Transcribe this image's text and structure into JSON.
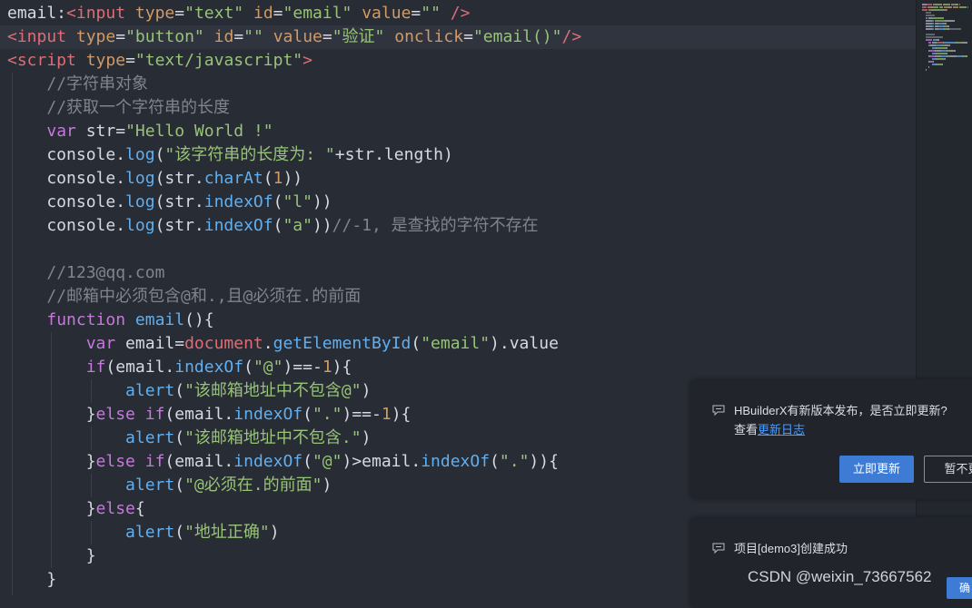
{
  "editor": {
    "lines": [
      [
        [
          "t-plain",
          "email:"
        ],
        [
          "t-tag",
          "<input"
        ],
        [
          "t-plain",
          " "
        ],
        [
          "t-attr",
          "type"
        ],
        [
          "t-plain",
          "="
        ],
        [
          "t-str",
          "\"text\""
        ],
        [
          "t-plain",
          " "
        ],
        [
          "t-attr",
          "id"
        ],
        [
          "t-plain",
          "="
        ],
        [
          "t-str",
          "\"email\""
        ],
        [
          "t-plain",
          " "
        ],
        [
          "t-attr",
          "value"
        ],
        [
          "t-plain",
          "="
        ],
        [
          "t-str",
          "\"\""
        ],
        [
          "t-plain",
          " "
        ],
        [
          "t-tag",
          "/>"
        ]
      ],
      [
        [
          "t-tag",
          "<input"
        ],
        [
          "t-plain",
          " "
        ],
        [
          "t-attr",
          "type"
        ],
        [
          "t-plain",
          "="
        ],
        [
          "t-str",
          "\"button\""
        ],
        [
          "t-plain",
          " "
        ],
        [
          "t-attr",
          "id"
        ],
        [
          "t-plain",
          "="
        ],
        [
          "t-str",
          "\"\""
        ],
        [
          "t-plain",
          " "
        ],
        [
          "t-attr",
          "value"
        ],
        [
          "t-plain",
          "="
        ],
        [
          "t-str",
          "\"验证\""
        ],
        [
          "t-plain",
          " "
        ],
        [
          "t-attr",
          "onclick"
        ],
        [
          "t-plain",
          "="
        ],
        [
          "t-str",
          "\"email()\""
        ],
        [
          "t-tag",
          "/>"
        ]
      ],
      [
        [
          "t-tag",
          "<script"
        ],
        [
          "t-plain",
          " "
        ],
        [
          "t-attr",
          "type"
        ],
        [
          "t-plain",
          "="
        ],
        [
          "t-str",
          "\"text/javascript\""
        ],
        [
          "t-tag",
          ">"
        ]
      ],
      [
        [
          "t-plain",
          "    "
        ],
        [
          "t-cm",
          "//字符串对象"
        ]
      ],
      [
        [
          "t-plain",
          "    "
        ],
        [
          "t-cm",
          "//获取一个字符串的长度"
        ]
      ],
      [
        [
          "t-plain",
          "    "
        ],
        [
          "t-kw",
          "var"
        ],
        [
          "t-plain",
          " str="
        ],
        [
          "t-str",
          "\"Hello World !\""
        ]
      ],
      [
        [
          "t-plain",
          "    console."
        ],
        [
          "t-fn",
          "log"
        ],
        [
          "t-plain",
          "("
        ],
        [
          "t-str",
          "\"该字符串的长度为: \""
        ],
        [
          "t-plain",
          "+str.length)"
        ]
      ],
      [
        [
          "t-plain",
          "    console."
        ],
        [
          "t-fn",
          "log"
        ],
        [
          "t-plain",
          "(str."
        ],
        [
          "t-fn",
          "charAt"
        ],
        [
          "t-plain",
          "("
        ],
        [
          "t-num",
          "1"
        ],
        [
          "t-plain",
          "))"
        ]
      ],
      [
        [
          "t-plain",
          "    console."
        ],
        [
          "t-fn",
          "log"
        ],
        [
          "t-plain",
          "(str."
        ],
        [
          "t-fn",
          "indexOf"
        ],
        [
          "t-plain",
          "("
        ],
        [
          "t-str",
          "\"l\""
        ],
        [
          "t-plain",
          "))"
        ]
      ],
      [
        [
          "t-plain",
          "    console."
        ],
        [
          "t-fn",
          "log"
        ],
        [
          "t-plain",
          "(str."
        ],
        [
          "t-fn",
          "indexOf"
        ],
        [
          "t-plain",
          "("
        ],
        [
          "t-str",
          "\"a\""
        ],
        [
          "t-plain",
          "))"
        ],
        [
          "t-cm",
          "//-1, 是查找的字符不存在"
        ]
      ],
      [
        [
          "t-plain",
          ""
        ]
      ],
      [
        [
          "t-plain",
          "    "
        ],
        [
          "t-cm",
          "//123@qq.com"
        ]
      ],
      [
        [
          "t-plain",
          "    "
        ],
        [
          "t-cm",
          "//邮箱中必须包含@和.,且@必须在.的前面"
        ]
      ],
      [
        [
          "t-plain",
          "    "
        ],
        [
          "t-kw",
          "function"
        ],
        [
          "t-plain",
          " "
        ],
        [
          "t-fn",
          "email"
        ],
        [
          "t-plain",
          "(){"
        ]
      ],
      [
        [
          "t-plain",
          "        "
        ],
        [
          "t-kw",
          "var"
        ],
        [
          "t-plain",
          " email="
        ],
        [
          "t-obj",
          "document"
        ],
        [
          "t-plain",
          "."
        ],
        [
          "t-fn",
          "getElementById"
        ],
        [
          "t-plain",
          "("
        ],
        [
          "t-str",
          "\"email\""
        ],
        [
          "t-plain",
          ").value"
        ]
      ],
      [
        [
          "t-plain",
          "        "
        ],
        [
          "t-kw",
          "if"
        ],
        [
          "t-plain",
          "(email."
        ],
        [
          "t-fn",
          "indexOf"
        ],
        [
          "t-plain",
          "("
        ],
        [
          "t-str",
          "\"@\""
        ],
        [
          "t-plain",
          ")==-"
        ],
        [
          "t-num",
          "1"
        ],
        [
          "t-plain",
          "){"
        ]
      ],
      [
        [
          "t-plain",
          "            "
        ],
        [
          "t-fn",
          "alert"
        ],
        [
          "t-plain",
          "("
        ],
        [
          "t-str",
          "\"该邮箱地址中不包含@\""
        ],
        [
          "t-plain",
          ")"
        ]
      ],
      [
        [
          "t-plain",
          "        }"
        ],
        [
          "t-kw",
          "else if"
        ],
        [
          "t-plain",
          "(email."
        ],
        [
          "t-fn",
          "indexOf"
        ],
        [
          "t-plain",
          "("
        ],
        [
          "t-str",
          "\".\""
        ],
        [
          "t-plain",
          ")==-"
        ],
        [
          "t-num",
          "1"
        ],
        [
          "t-plain",
          "){"
        ]
      ],
      [
        [
          "t-plain",
          "            "
        ],
        [
          "t-fn",
          "alert"
        ],
        [
          "t-plain",
          "("
        ],
        [
          "t-str",
          "\"该邮箱地址中不包含.\""
        ],
        [
          "t-plain",
          ")"
        ]
      ],
      [
        [
          "t-plain",
          "        }"
        ],
        [
          "t-kw",
          "else if"
        ],
        [
          "t-plain",
          "(email."
        ],
        [
          "t-fn",
          "indexOf"
        ],
        [
          "t-plain",
          "("
        ],
        [
          "t-str",
          "\"@\""
        ],
        [
          "t-plain",
          ")>email."
        ],
        [
          "t-fn",
          "indexOf"
        ],
        [
          "t-plain",
          "("
        ],
        [
          "t-str",
          "\".\""
        ],
        [
          "t-plain",
          ")){"
        ]
      ],
      [
        [
          "t-plain",
          "            "
        ],
        [
          "t-fn",
          "alert"
        ],
        [
          "t-plain",
          "("
        ],
        [
          "t-str",
          "\"@必须在.的前面\""
        ],
        [
          "t-plain",
          ")"
        ]
      ],
      [
        [
          "t-plain",
          "        }"
        ],
        [
          "t-kw",
          "else"
        ],
        [
          "t-plain",
          "{"
        ]
      ],
      [
        [
          "t-plain",
          "            "
        ],
        [
          "t-fn",
          "alert"
        ],
        [
          "t-plain",
          "("
        ],
        [
          "t-str",
          "\"地址正确\""
        ],
        [
          "t-plain",
          ")"
        ]
      ],
      [
        [
          "t-plain",
          "        }"
        ]
      ],
      [
        [
          "t-plain",
          "    }"
        ]
      ]
    ]
  },
  "notifications": {
    "update": {
      "message": "HBuilderX有新版本发布，是否立即更新?",
      "view_prefix": "查看",
      "changelog_link": "更新日志",
      "update_now_label": "立即更新",
      "later_label": "暂不更"
    },
    "project": {
      "message": "项目[demo3]创建成功"
    },
    "confirm_label": "确"
  },
  "watermark": "CSDN @weixin_73667562",
  "colors": {
    "editor_bg": "#282c34",
    "accent": "#3d7bd5",
    "link": "#4c9bff"
  },
  "icons": {
    "notify": "chat-bubble-icon"
  }
}
